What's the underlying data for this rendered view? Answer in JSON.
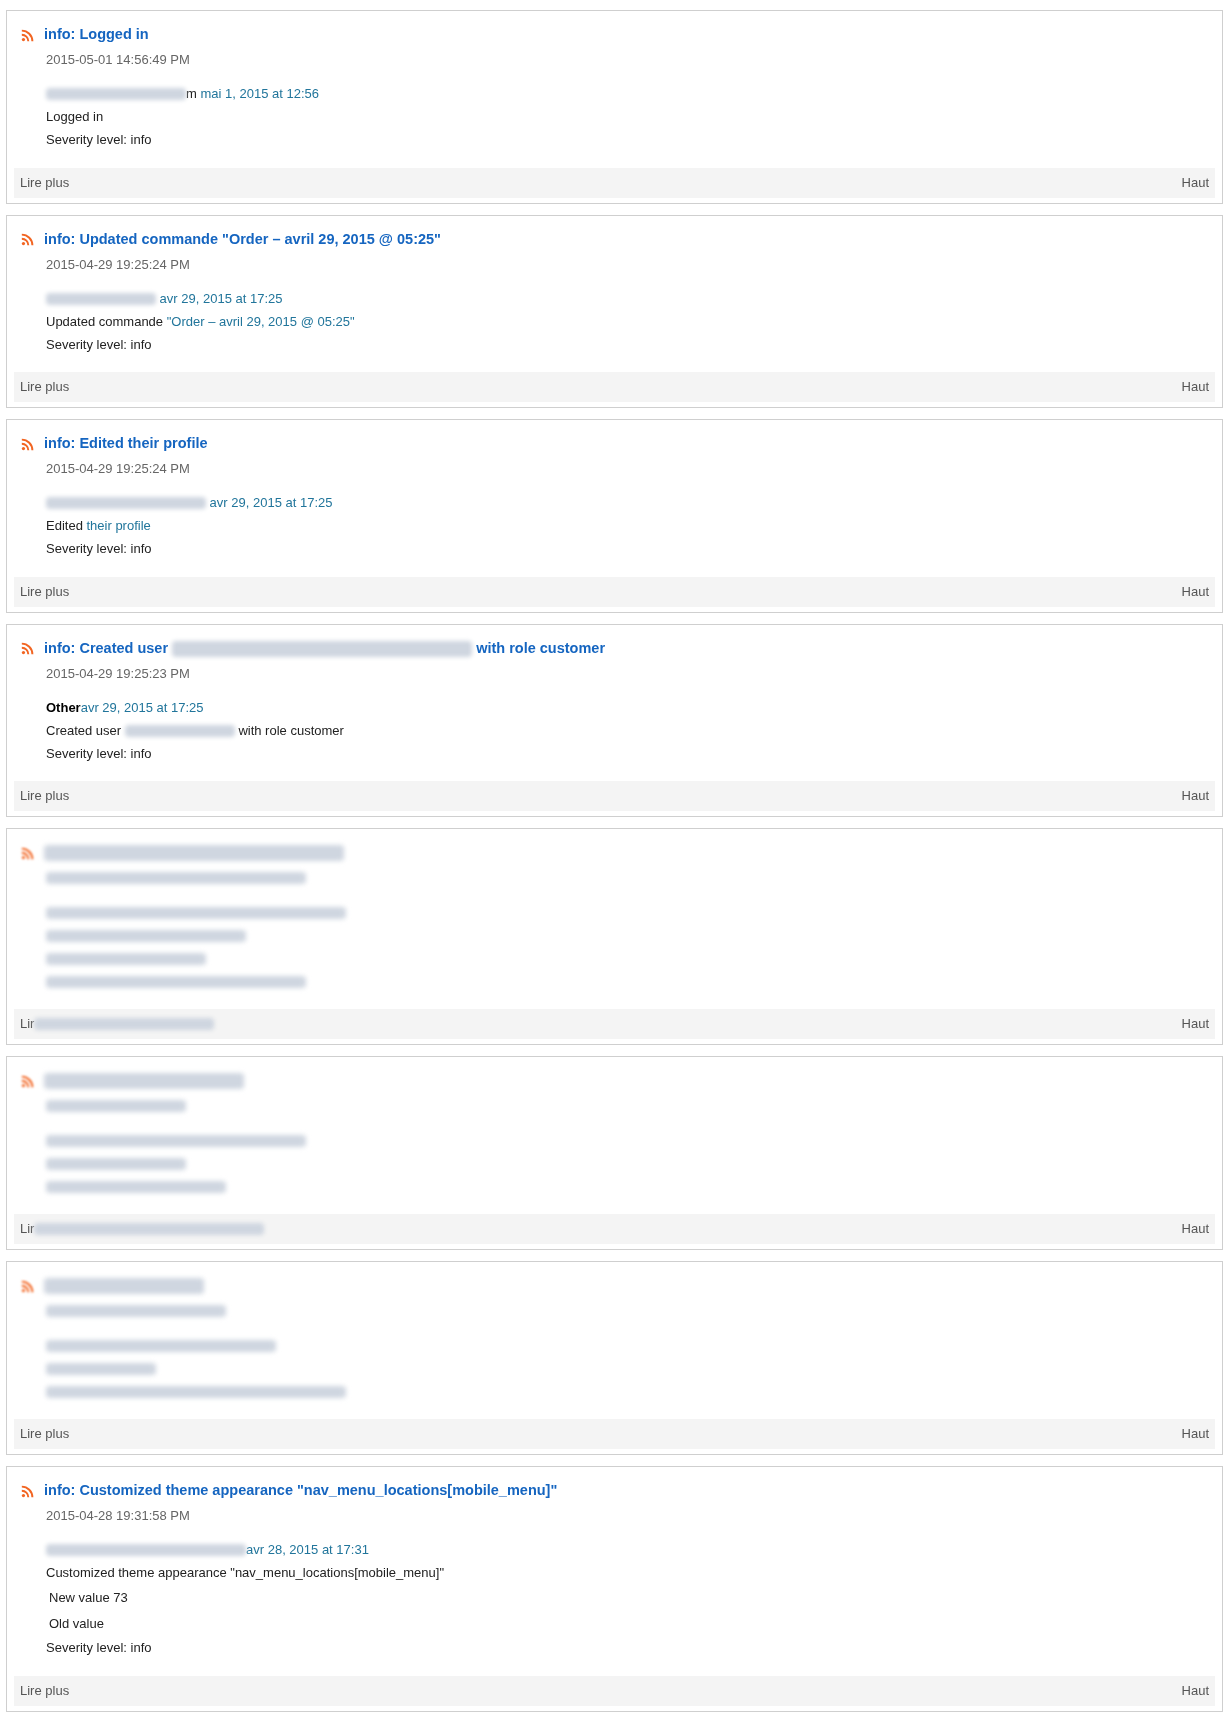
{
  "entries": [
    {
      "blurred": false,
      "title": [
        {
          "kind": "text",
          "text": "info: Logged in"
        }
      ],
      "date": "2015-05-01 14:56:49 PM",
      "lines": [
        {
          "indent": false,
          "segments": [
            {
              "kind": "redacted"
            },
            {
              "kind": "text",
              "text": "m"
            },
            {
              "kind": "link",
              "text": " mai 1, 2015 at 12:56"
            }
          ]
        },
        {
          "indent": false,
          "segments": [
            {
              "kind": "text",
              "text": "Logged in"
            }
          ]
        },
        {
          "indent": false,
          "segments": [
            {
              "kind": "text",
              "text": "Severity level: info"
            }
          ]
        }
      ],
      "footer_left": [
        {
          "kind": "text",
          "text": "Lire plus"
        }
      ],
      "footer_right": "Haut"
    },
    {
      "blurred": false,
      "title": [
        {
          "kind": "text",
          "text": "info: Updated commande \"Order – avril 29, 2015 @ 05:25\""
        }
      ],
      "date": "2015-04-29 19:25:24 PM",
      "lines": [
        {
          "indent": false,
          "segments": [
            {
              "kind": "redacted"
            },
            {
              "kind": "link",
              "text": " avr 29, 2015 at 17:25"
            }
          ]
        },
        {
          "indent": false,
          "segments": [
            {
              "kind": "text",
              "text": "Updated commande "
            },
            {
              "kind": "link",
              "text": "\"Order – avril 29, 2015 @ 05:25\""
            }
          ]
        },
        {
          "indent": false,
          "segments": [
            {
              "kind": "text",
              "text": "Severity level: info"
            }
          ]
        }
      ],
      "footer_left": [
        {
          "kind": "text",
          "text": "Lire plus"
        }
      ],
      "footer_right": "Haut"
    },
    {
      "blurred": false,
      "title": [
        {
          "kind": "text",
          "text": "info: Edited their profile"
        }
      ],
      "date": "2015-04-29 19:25:24 PM",
      "lines": [
        {
          "indent": false,
          "segments": [
            {
              "kind": "redacted"
            },
            {
              "kind": "link",
              "text": " avr 29, 2015 at 17:25"
            }
          ]
        },
        {
          "indent": false,
          "segments": [
            {
              "kind": "text",
              "text": "Edited "
            },
            {
              "kind": "link",
              "text": "their profile"
            }
          ]
        },
        {
          "indent": false,
          "segments": [
            {
              "kind": "text",
              "text": "Severity level: info"
            }
          ]
        }
      ],
      "footer_left": [
        {
          "kind": "text",
          "text": "Lire plus"
        }
      ],
      "footer_right": "Haut"
    },
    {
      "blurred": false,
      "title": [
        {
          "kind": "text",
          "text": "info: Created user "
        },
        {
          "kind": "redacted"
        },
        {
          "kind": "text",
          "text": " with role customer"
        }
      ],
      "date": "2015-04-29 19:25:23 PM",
      "lines": [
        {
          "indent": false,
          "segments": [
            {
              "kind": "bold",
              "text": "Other"
            },
            {
              "kind": "link",
              "text": "avr 29, 2015 at 17:25"
            }
          ]
        },
        {
          "indent": false,
          "segments": [
            {
              "kind": "text",
              "text": "Created user "
            },
            {
              "kind": "redacted"
            },
            {
              "kind": "text",
              "text": " with role customer"
            }
          ]
        },
        {
          "indent": false,
          "segments": [
            {
              "kind": "text",
              "text": "Severity level: info"
            }
          ]
        }
      ],
      "footer_left": [
        {
          "kind": "text",
          "text": "Lire plus"
        }
      ],
      "footer_right": "Haut"
    },
    {
      "blurred": true,
      "title": [
        {
          "kind": "redacted"
        }
      ],
      "lines": [
        {
          "indent": false,
          "segments": [
            {
              "kind": "redacted"
            }
          ]
        },
        {
          "indent": false,
          "segments": [
            {
              "kind": "redacted"
            }
          ]
        },
        {
          "indent": false,
          "segments": [
            {
              "kind": "redacted"
            }
          ]
        },
        {
          "indent": false,
          "segments": [
            {
              "kind": "redacted"
            }
          ]
        }
      ],
      "footer_left": [
        {
          "kind": "text",
          "text": "Lir"
        },
        {
          "kind": "redacted"
        }
      ],
      "footer_right": "Haut"
    },
    {
      "blurred": true,
      "title": [
        {
          "kind": "redacted"
        }
      ],
      "lines": [
        {
          "indent": false,
          "segments": [
            {
              "kind": "redacted"
            }
          ]
        },
        {
          "indent": false,
          "segments": [
            {
              "kind": "redacted"
            }
          ]
        },
        {
          "indent": false,
          "segments": [
            {
              "kind": "redacted"
            }
          ]
        }
      ],
      "footer_left": [
        {
          "kind": "text",
          "text": "Lir"
        },
        {
          "kind": "redacted"
        }
      ],
      "footer_right": "Haut"
    },
    {
      "blurred": true,
      "title": [
        {
          "kind": "redacted"
        }
      ],
      "lines": [
        {
          "indent": false,
          "segments": [
            {
              "kind": "redacted"
            }
          ]
        },
        {
          "indent": false,
          "segments": [
            {
              "kind": "redacted"
            }
          ]
        },
        {
          "indent": false,
          "segments": [
            {
              "kind": "redacted"
            }
          ]
        }
      ],
      "footer_left": [
        {
          "kind": "text",
          "text": "Lire plus"
        }
      ],
      "footer_right": "Haut"
    },
    {
      "blurred": false,
      "title": [
        {
          "kind": "text",
          "text": "info: Customized theme appearance \"nav_menu_locations[mobile_menu]\""
        }
      ],
      "date": "2015-04-28 19:31:58 PM",
      "lines": [
        {
          "indent": false,
          "segments": [
            {
              "kind": "redacted"
            },
            {
              "kind": "link",
              "text": "avr 28, 2015 at 17:31"
            }
          ]
        },
        {
          "indent": false,
          "segments": [
            {
              "kind": "text",
              "text": "Customized theme appearance \"nav_menu_locations[mobile_menu]\""
            }
          ]
        },
        {
          "indent": true,
          "segments": [
            {
              "kind": "text",
              "text": "New value 73"
            }
          ]
        },
        {
          "indent": true,
          "segments": [
            {
              "kind": "text",
              "text": "Old value"
            }
          ]
        },
        {
          "indent": false,
          "segments": [
            {
              "kind": "text",
              "text": "Severity level: info"
            }
          ]
        }
      ],
      "footer_left": [
        {
          "kind": "text",
          "text": "Lire plus"
        }
      ],
      "footer_right": "Haut"
    }
  ]
}
